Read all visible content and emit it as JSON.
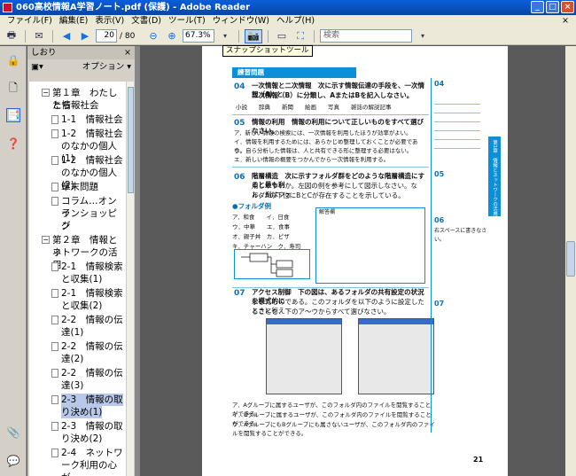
{
  "window": {
    "title": "060高校情報A学習ノート.pdf (保護) - Adobe Reader",
    "min": "_",
    "max": "□",
    "close": "×"
  },
  "menu": [
    "ファイル(F)",
    "編集(E)",
    "表示(V)",
    "文書(D)",
    "ツール(T)",
    "ウィンドウ(W)",
    "ヘルプ(H)"
  ],
  "menu_close": "×",
  "toolbar": {
    "page_current": "20",
    "page_total": "/ 80",
    "zoom": "67.3%",
    "search_placeholder": "検索",
    "tooltip": "スナップショットツール"
  },
  "bookmarks": {
    "header": "しおり",
    "close": "×",
    "options": "オプション ▾",
    "items": [
      {
        "label": "第１章　わたしたち",
        "expander": "−"
      },
      {
        "label": "と情報社会"
      },
      {
        "label": "1-1　情報社会"
      },
      {
        "label": "1-2　情報社会"
      },
      {
        "label": "のなかの個人(1)"
      },
      {
        "label": "1-2　情報社会"
      },
      {
        "label": "のなかの個人(2)"
      },
      {
        "label": "章末問題"
      },
      {
        "label": "コラム…オンラ"
      },
      {
        "label": "インショッピン"
      },
      {
        "label": "グ"
      },
      {
        "label": "第２章　情報とネ",
        "expander": "−"
      },
      {
        "label": "ットワークの活用"
      },
      {
        "label": "2-1　情報検索"
      },
      {
        "label": "と収集(1)"
      },
      {
        "label": "2-1　情報検索"
      },
      {
        "label": "と収集(2)"
      },
      {
        "label": "2-2　情報の伝"
      },
      {
        "label": "達(1)"
      },
      {
        "label": "2-2　情報の伝"
      },
      {
        "label": "達(2)"
      },
      {
        "label": "2-2　情報の伝"
      },
      {
        "label": "達(3)"
      },
      {
        "label": "2-3　情報の取"
      },
      {
        "label": "り決め(1)"
      },
      {
        "label": "2-3　情報の取"
      },
      {
        "label": "り決め(2)"
      },
      {
        "label": "2-4　ネットワ"
      },
      {
        "label": "ーク利用の心が"
      }
    ]
  },
  "document": {
    "section_label": "練習問題",
    "q04": "04",
    "q04_text": "一次情報と二次情報　次に示す情報伝達の手段を、一次情報（A）と",
    "q04_text2": "二次情報（B）に分類し、AまたはBを記入しなさい。",
    "q04_options": "小説　　辞典　　新聞　　絵画　　写真　　雑誌の解説記事",
    "q05": "05",
    "q05_text": "情報の利用　情報の利用について正しいものをすべて選びなさい。",
    "q05_a": "ア．新しい情報の検索には、一次情報を利用したほうが効率がよい。",
    "q05_b": "イ．情報を利用するためには、あらかじめ整理しておくことが必要である。",
    "q05_c": "ウ．自ら分析した情報は、人と共有できる形に整理する必要はない。",
    "q05_d": "エ．新しい情報の概要をつかんでから一次情報を利用する。",
    "q06": "06",
    "q06_text": "階層構造　次に示すフォルダ群をどのような階層構造にすると最も利",
    "q06_text2": "用しやすいか。左図の例を参考にして図示しなさい。なお、例はフォ",
    "q06_text3": "ルダAの下位にBとCが存在することを示している。",
    "q06_folders_label": "●フォルダ例",
    "q06_folders": "ア．和食　　イ．日食",
    "q06_folders2": "ウ．中華　　エ．食事",
    "q06_folders3": "オ．親子丼　カ．ピザ",
    "q06_folders4": "キ．チャーハン　ク．寿司",
    "q06_box_label": "解答欄",
    "q07": "07",
    "q07_text": "アクセス制御　下の図は、あるフォルダの共有設定の状況を模式的に",
    "q07_text2": "示したものである。このフォルダを以下のように設定したときに行え",
    "q07_text3": "ることを、下のア〜ウからすべて選びなさい。",
    "q07_a": "ア．Aグループに属するユーザが、このフォルダ内のファイルを閲覧することができる。",
    "q07_b": "イ．Bグループに属するユーザが、このフォルダ内のファイルを閲覧することができる。",
    "q07_c": "ウ．AグループにもBグループにも属さないユーザが、このフォルダ内のファイルを閲覧することができる。",
    "side_04": "04",
    "side_05": "05",
    "side_06": "06",
    "side_06_note": "右スペースに書きなさい。",
    "side_07": "07",
    "side_tab": "第1章　情報とネットワークの活用",
    "page_number": "21"
  }
}
